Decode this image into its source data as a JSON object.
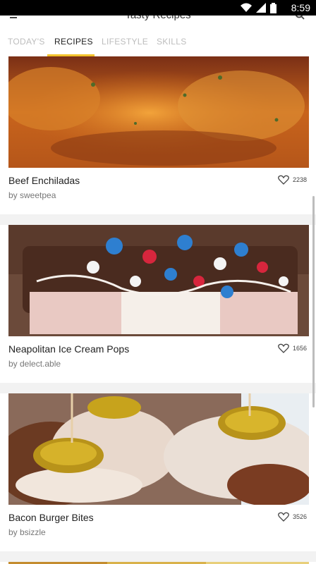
{
  "status": {
    "time": "8:59"
  },
  "appbar": {
    "title": "Tasty Recipes"
  },
  "tabs": [
    {
      "label": "TODAY'S"
    },
    {
      "label": "RECIPES"
    },
    {
      "label": "LIFESTYLE"
    },
    {
      "label": "SKILLS"
    }
  ],
  "active_tab": "RECIPES",
  "colors": {
    "accent": "#f2c32c",
    "text": "#222222",
    "muted": "#777777"
  },
  "recipes": [
    {
      "name": "Beef Enchiladas",
      "author": "by sweetpea",
      "likes": "2238"
    },
    {
      "name": "Neapolitan Ice Cream Pops",
      "author": "by delect.able",
      "likes": "1656"
    },
    {
      "name": "Bacon Burger Bites",
      "author": "by bsizzle",
      "likes": "3526"
    }
  ]
}
